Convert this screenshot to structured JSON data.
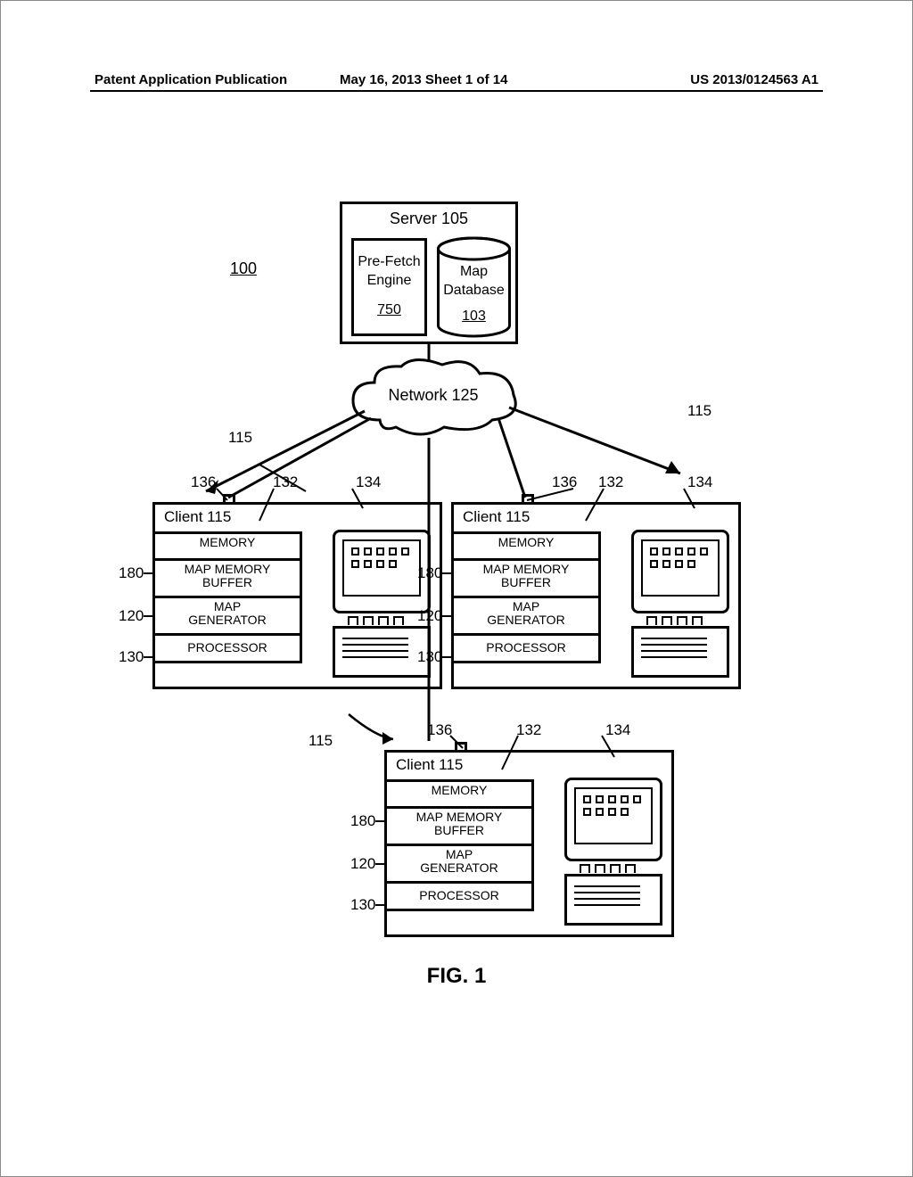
{
  "header": {
    "left": "Patent Application Publication",
    "middle": "May 16, 2013  Sheet 1 of 14",
    "right": "US 2013/0124563 A1"
  },
  "system_ref": "100",
  "server": {
    "title": "Server 105",
    "prefetch_l1": "Pre-Fetch",
    "prefetch_l2": "Engine",
    "prefetch_ref": "750",
    "db_l1": "Map",
    "db_l2": "Database",
    "db_ref": "103"
  },
  "network_label": "Network 125",
  "client_ref": "115",
  "client_title": "Client 115",
  "stack": {
    "memory": "MEMORY",
    "map_mem_l1": "MAP MEMORY",
    "map_mem_l2": "BUFFER",
    "map_gen_l1": "MAP",
    "map_gen_l2": "GENERATOR",
    "processor": "PROCESSOR"
  },
  "side_refs": {
    "memory_buffer": "180",
    "map_generator": "120",
    "processor": "130"
  },
  "top_refs": {
    "antenna": "136",
    "memory_block": "132",
    "phone": "134"
  },
  "figure_caption": "FIG. 1"
}
